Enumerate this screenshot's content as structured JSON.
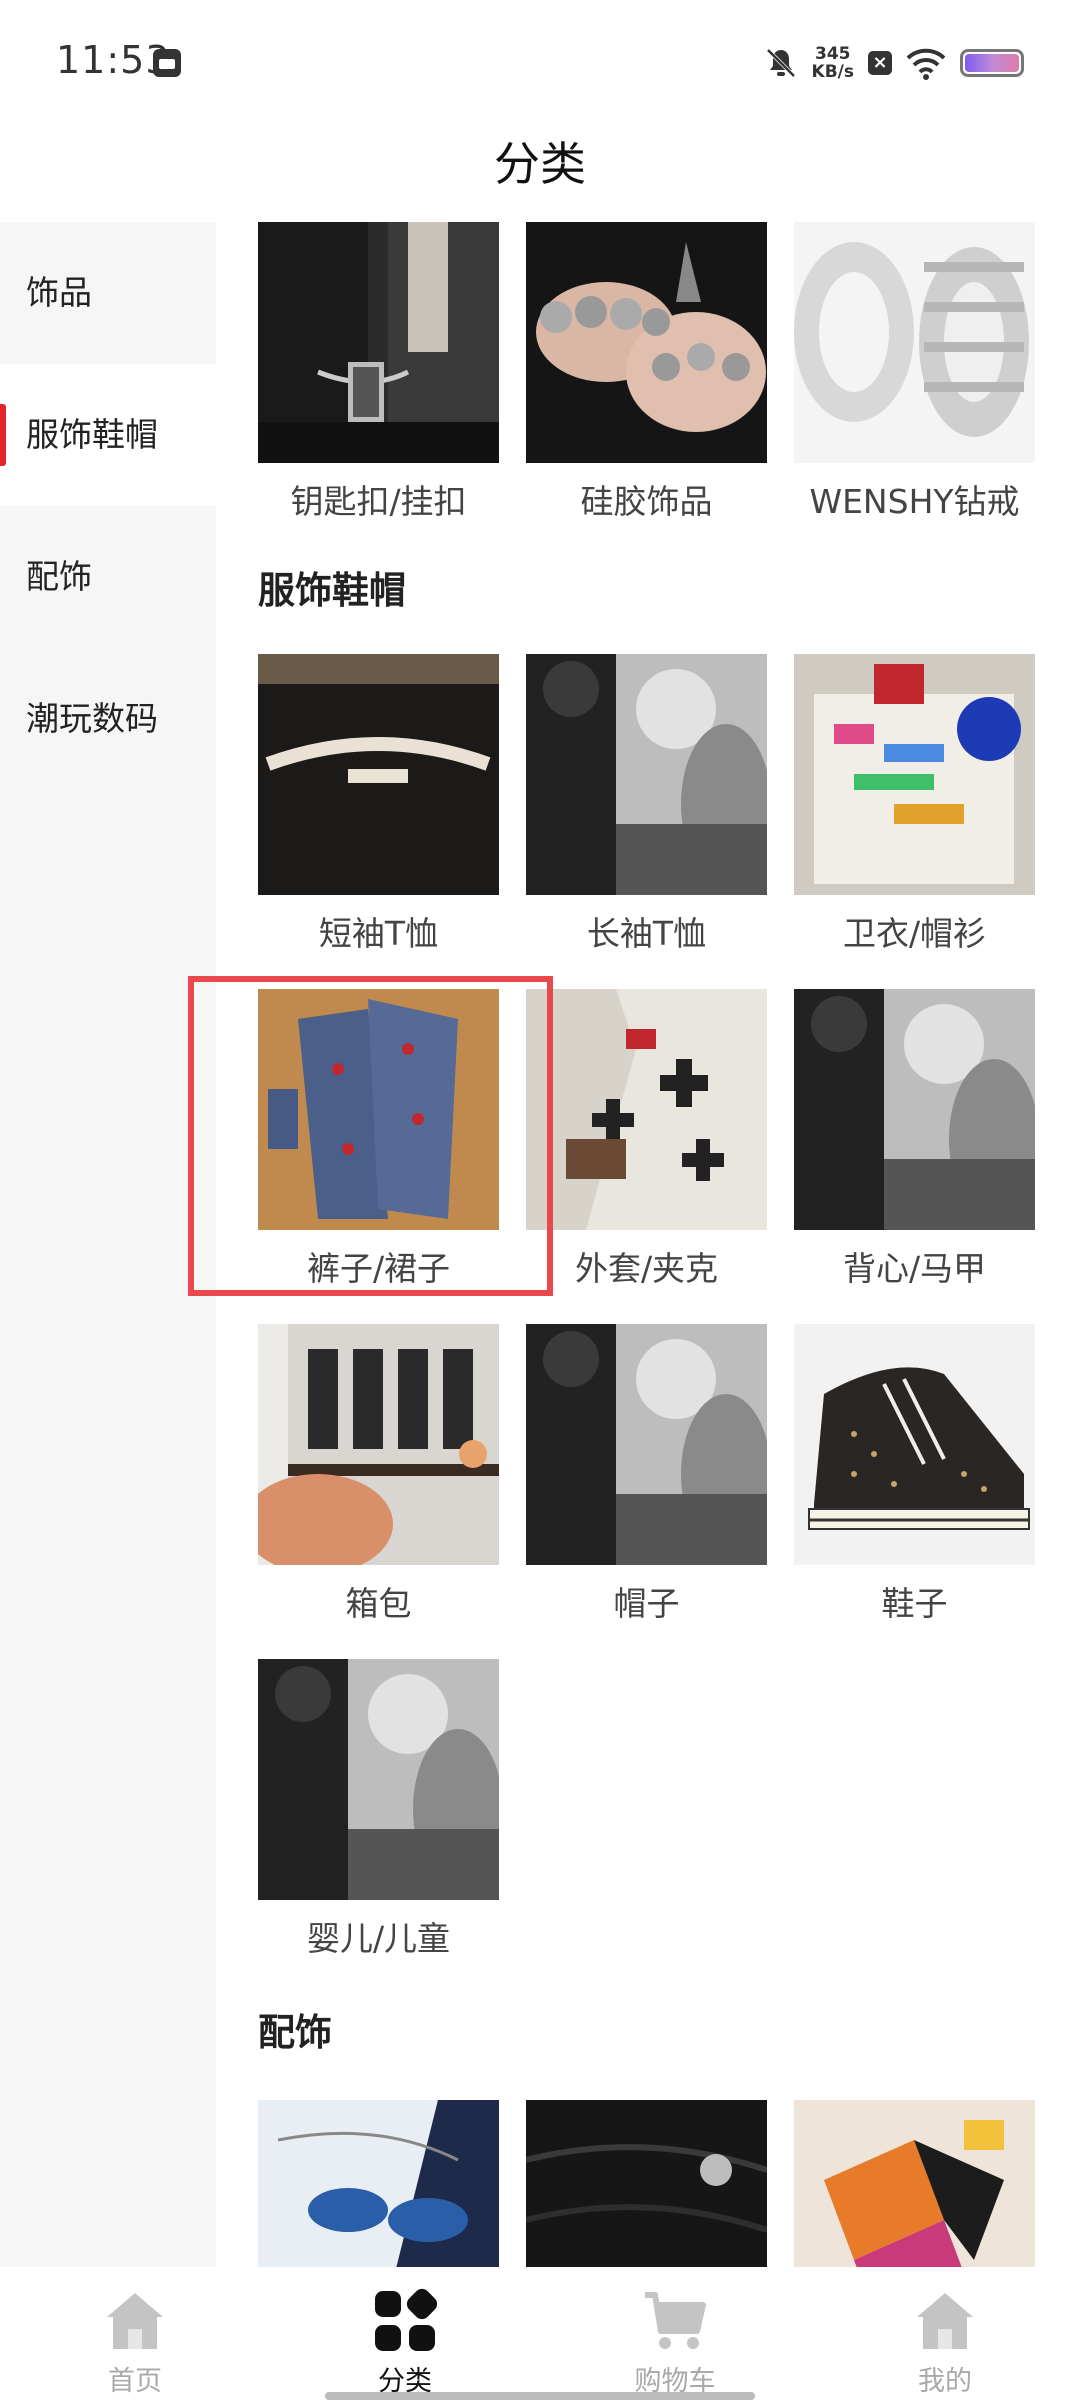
{
  "status": {
    "time": "11:53",
    "speed_value": "345",
    "speed_unit": "KB/s"
  },
  "page": {
    "title": "分类"
  },
  "sidebar": {
    "items": [
      {
        "label": "饰品"
      },
      {
        "label": "服饰鞋帽"
      },
      {
        "label": "配饰"
      },
      {
        "label": "潮玩数码"
      }
    ],
    "active_index": 1
  },
  "content": {
    "top_row": [
      {
        "label": "钥匙扣/挂扣",
        "image": "keychain-photo"
      },
      {
        "label": "硅胶饰品",
        "image": "rings-hands-photo"
      },
      {
        "label": "WENSHY钻戒",
        "image": "diamond-rings-photo"
      }
    ],
    "section_apparel": {
      "title": "服饰鞋帽",
      "items": [
        {
          "label": "短袖T恤",
          "image": "black-tshirt-photo"
        },
        {
          "label": "长袖T恤",
          "image": "bw-people-photo"
        },
        {
          "label": "卫衣/帽衫",
          "image": "hoodie-caps-photo"
        },
        {
          "label": "裤子/裙子",
          "image": "denim-shirts-photo"
        },
        {
          "label": "外套/夹克",
          "image": "cross-jacket-photo"
        },
        {
          "label": "背心/马甲",
          "image": "bw-people-photo"
        },
        {
          "label": "箱包",
          "image": "store-flowers-photo"
        },
        {
          "label": "帽子",
          "image": "bw-people-photo"
        },
        {
          "label": "鞋子",
          "image": "high-top-sneaker-photo"
        },
        {
          "label": "婴儿/儿童",
          "image": "bw-people-photo"
        }
      ]
    },
    "section_accessories": {
      "title": "配饰",
      "items": [
        {
          "image": "eyewear-chain-photo"
        },
        {
          "image": "leather-bag-photo"
        },
        {
          "image": "colorful-scarf-photo"
        }
      ]
    }
  },
  "bottom_nav": [
    {
      "label": "首页",
      "icon": "home-icon"
    },
    {
      "label": "分类",
      "icon": "category-icon"
    },
    {
      "label": "购物车",
      "icon": "cart-icon"
    },
    {
      "label": "我的",
      "icon": "profile-icon"
    }
  ],
  "colors": {
    "accent": "#e5252b",
    "highlight_box": "#e8494a",
    "sidebar_bg": "#f6f6f6"
  }
}
